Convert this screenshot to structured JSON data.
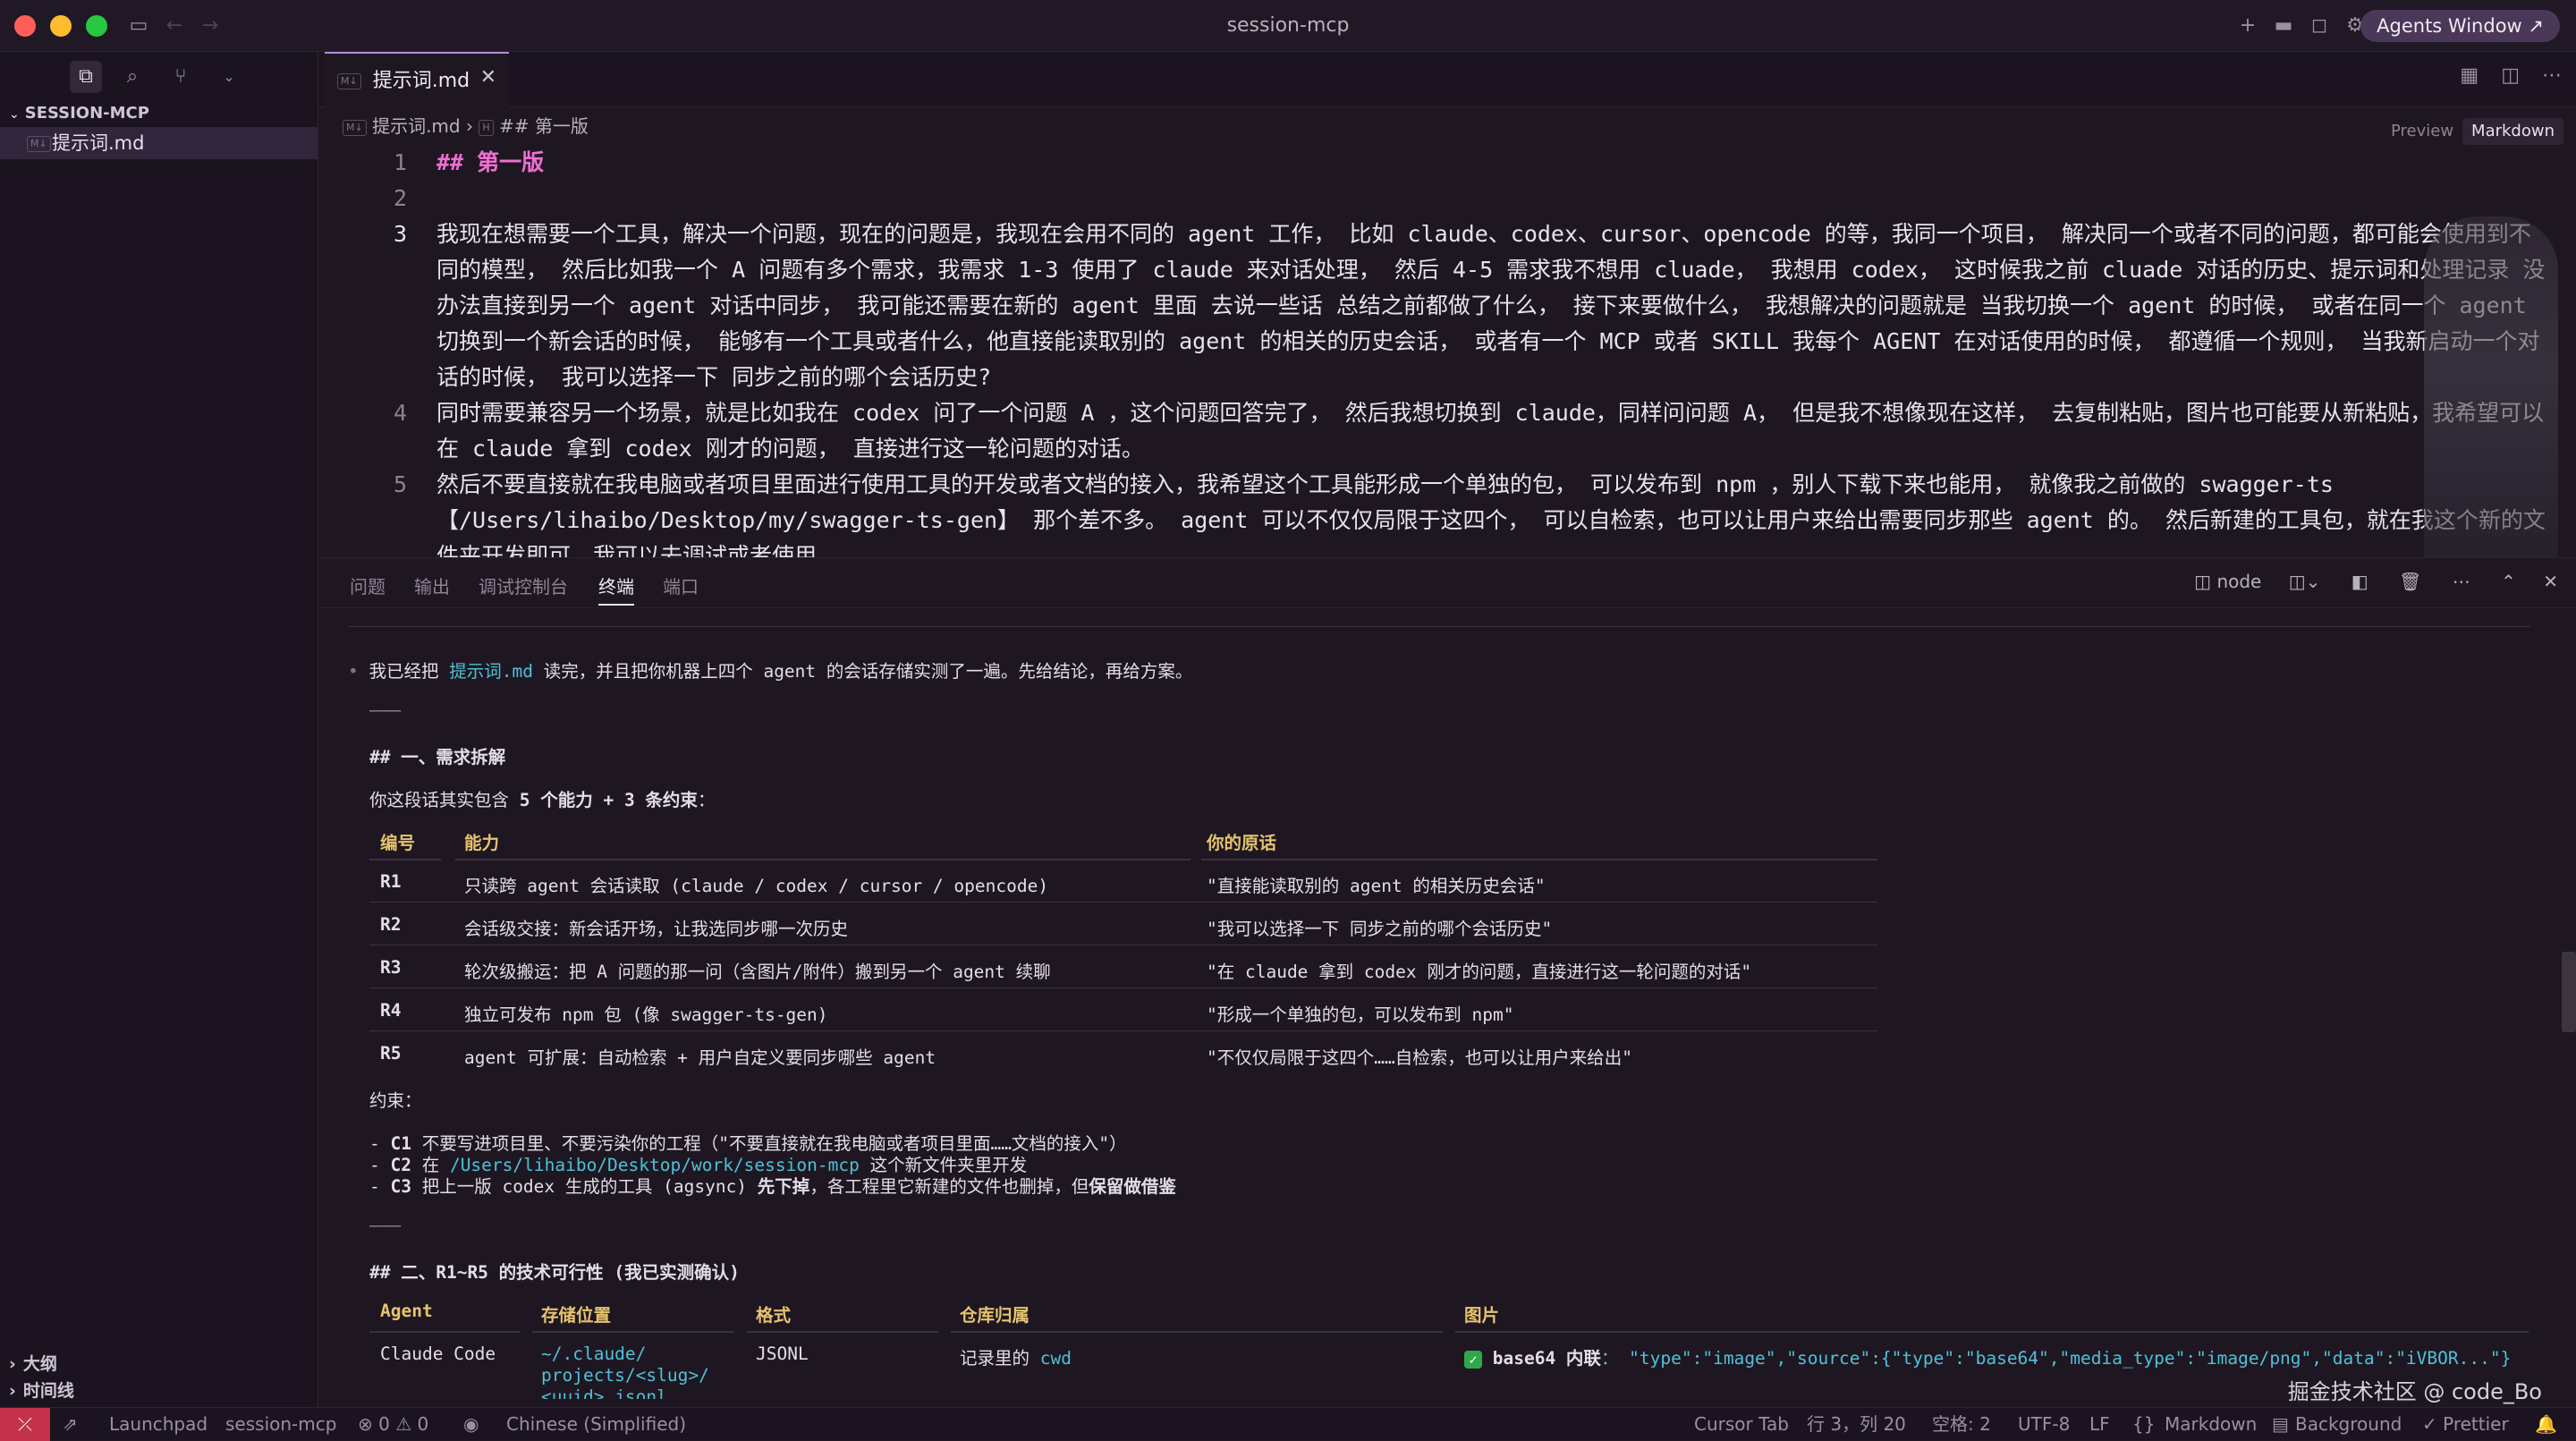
{
  "window": {
    "title": "session-mcp",
    "agents_button": "Agents Window ↗"
  },
  "sidebar": {
    "section": "SESSION-MCP",
    "file": "提示词.md",
    "outline": "大纲",
    "timeline": "时间线"
  },
  "editor": {
    "tab": "提示词.md",
    "breadcrumb_file": "提示词.md",
    "breadcrumb_section": "## 第一版",
    "preview": "Preview",
    "markdown": "Markdown",
    "lines": [
      {
        "n": "1",
        "text": "## 第一版"
      },
      {
        "n": "2",
        "text": ""
      },
      {
        "n": "3",
        "text": "我现在想需要一个工具，解决一个问题，现在的问题是，我现在会用不同的 agent 工作， 比如 claude、codex、cursor、opencode 的等，我同一个项目， 解决同一个或者不同的问题，都可能会使用到不同的模型， 然后比如我一个 A 问题有多个需求，我需求 1-3 使用了 claude 来对话处理， 然后 4-5 需求我不想用 cluade， 我想用 codex， 这时候我之前 cluade 对话的历史、提示词和处理记录 没办法直接到另一个 agent 对话中同步， 我可能还需要在新的 agent 里面 去说一些话 总结之前都做了什么， 接下来要做什么， 我想解决的问题就是 当我切换一个 agent 的时候， 或者在同一个 agent 切换到一个新会话的时候， 能够有一个工具或者什么，他直接能读取别的 agent 的相关的历史会话， 或者有一个 MCP 或者 SKILL 我每个 AGENT 在对话使用的时候， 都遵循一个规则， 当我新启动一个对话的时候， 我可以选择一下 同步之前的哪个会话历史?"
      },
      {
        "n": "4",
        "text": "同时需要兼容另一个场景，就是比如我在 codex 问了一个问题 A ，这个问题回答完了， 然后我想切换到 claude，同样问问题 A， 但是我不想像现在这样， 去复制粘贴，图片也可能要从新粘贴，我希望可以在 claude 拿到 codex 刚才的问题， 直接进行这一轮问题的对话。"
      },
      {
        "n": "5",
        "text": "然后不要直接就在我电脑或者项目里面进行使用工具的开发或者文档的接入，我希望这个工具能形成一个单独的包， 可以发布到 npm ，别人下载下来也能用， 就像我之前做的 swagger-ts【/Users/lihaibo/Desktop/my/swagger-ts-gen】 那个差不多。 agent 可以不仅仅局限于这四个， 可以自检索，也可以让用户来给出需要同步那些 agent 的。 然后新建的工具包，就在我这个新的文件夹开发即可，我可以去调试或者使用。"
      }
    ]
  },
  "panel": {
    "tabs": [
      "问题",
      "输出",
      "调试控制台",
      "终端",
      "端口"
    ],
    "terminal_name": "node",
    "intro_pre": "我已经把 ",
    "intro_file": "提示词.md",
    "intro_post": " 读完，并且把你机器上四个 agent 的会话存储实测了一遍。先给结论，再给方案。",
    "hr": "———",
    "sec1_title": "## 一、需求拆解",
    "sec1_intro_pre": "你这段话其实包含 ",
    "sec1_intro_bold": "5 个能力 + 3 条约束",
    "sec1_intro_post": "：",
    "table1_headers": [
      "编号",
      "能力",
      "你的原话"
    ],
    "table1_rows": [
      {
        "id": "R1",
        "cap": "只读跨 agent 会话读取 (claude / codex / cursor / opencode)",
        "quote": "\"直接能读取别的 agent 的相关历史会话\""
      },
      {
        "id": "R2",
        "cap": "会话级交接：新会话开场，让我选同步哪一次历史",
        "quote": "\"我可以选择一下 同步之前的哪个会话历史\""
      },
      {
        "id": "R3",
        "cap": "轮次级搬运：把 A 问题的那一问（含图片/附件）搬到另一个 agent 续聊",
        "quote": "\"在 claude 拿到 codex 刚才的问题，直接进行这一轮问题的对话\""
      },
      {
        "id": "R4",
        "cap": "独立可发布 npm 包 (像 swagger-ts-gen)",
        "quote": "\"形成一个单独的包，可以发布到 npm\""
      },
      {
        "id": "R5",
        "cap": "agent 可扩展：自动检索 + 用户自定义要同步哪些 agent",
        "quote": "\"不仅仅局限于这四个……自检索，也可以让用户来给出\""
      }
    ],
    "constraints_label": "约束：",
    "c1_id": "C1",
    "c1_text": " 不要写进项目里、不要污染你的工程（\"不要直接就在我电脑或者项目里面……文档的接入\"）",
    "c2_id": "C2",
    "c2_pre": " 在 ",
    "c2_path": "/Users/lihaibo/Desktop/work/session-mcp",
    "c2_post": " 这个新文件夹里开发",
    "c3_id": "C3",
    "c3_pre": " 把上一版 codex 生成的工具 (agsync) ",
    "c3_bold1": "先下掉",
    "c3_mid": "，各工程里它新建的文件也删掉，但",
    "c3_bold2": "保留做借鉴",
    "sec2_title": "## 二、R1~R5 的技术可行性 (我已实测确认)",
    "table2_headers": [
      "Agent",
      "存储位置",
      "格式",
      "仓库归属",
      "图片"
    ],
    "table2_row": {
      "agent": "Claude Code",
      "loc1": "~/.claude/",
      "loc2": "projects/<slug>/",
      "loc3": "<uuid>.jsonl",
      "fmt": "JSONL",
      "repo_pre": "记录里的 ",
      "repo_cwd": "cwd",
      "img_bold": "base64 内联",
      "img_code": "： \"type\":\"image\",\"source\":{\"type\":\"base64\",\"media_type\":\"image/png\",\"data\":\"iVBOR...\"}"
    }
  },
  "statusbar": {
    "launchpad": "Launchpad",
    "project": "session-mcp",
    "problems": "⊗ 0 ⚠ 0",
    "language_ui": "Chinese (Simplified)",
    "cursor_tab": "Cursor Tab",
    "position": "行 3，列 20",
    "spaces": "空格: 2",
    "encoding": "UTF-8",
    "eol": "LF",
    "lang": "Markdown",
    "background": "Background",
    "prettier": "✓ Prettier"
  },
  "watermark": "掘金技术社区 @ code_Bo"
}
